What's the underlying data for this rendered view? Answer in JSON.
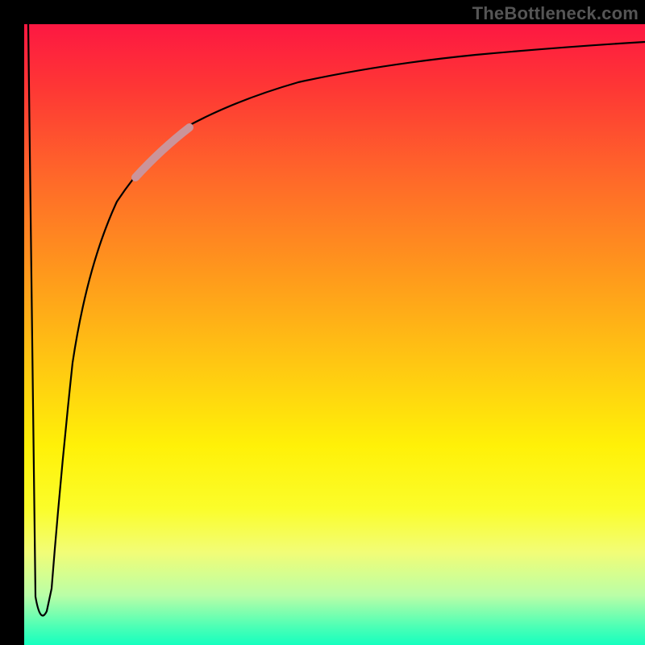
{
  "watermark": "TheBottleneck.com",
  "chart_data": {
    "type": "line",
    "title": "",
    "xlabel": "",
    "ylabel": "",
    "xlim": [
      0,
      100
    ],
    "ylim": [
      0,
      100
    ],
    "grid": false,
    "legend": false,
    "background_gradient": {
      "direction": "vertical",
      "stops": [
        {
          "pos": 0,
          "color": "#fd1842"
        },
        {
          "pos": 0.5,
          "color": "#ffc812"
        },
        {
          "pos": 0.8,
          "color": "#fbfd2a"
        },
        {
          "pos": 1,
          "color": "#15ffbf"
        }
      ]
    },
    "series": [
      {
        "name": "curve",
        "points": [
          {
            "x": 0,
            "y": 100
          },
          {
            "x": 2.2,
            "y": 5
          },
          {
            "x": 4,
            "y": 3
          },
          {
            "x": 5,
            "y": 10
          },
          {
            "x": 6,
            "y": 30
          },
          {
            "x": 8,
            "y": 50
          },
          {
            "x": 12,
            "y": 65
          },
          {
            "x": 18,
            "y": 76
          },
          {
            "x": 25,
            "y": 82
          },
          {
            "x": 35,
            "y": 87
          },
          {
            "x": 50,
            "y": 91
          },
          {
            "x": 70,
            "y": 94
          },
          {
            "x": 100,
            "y": 96
          }
        ]
      },
      {
        "name": "highlight-segment",
        "color": "#c98c8c",
        "width": 8,
        "points": [
          {
            "x": 18,
            "y": 76
          },
          {
            "x": 25,
            "y": 82
          }
        ]
      }
    ]
  }
}
